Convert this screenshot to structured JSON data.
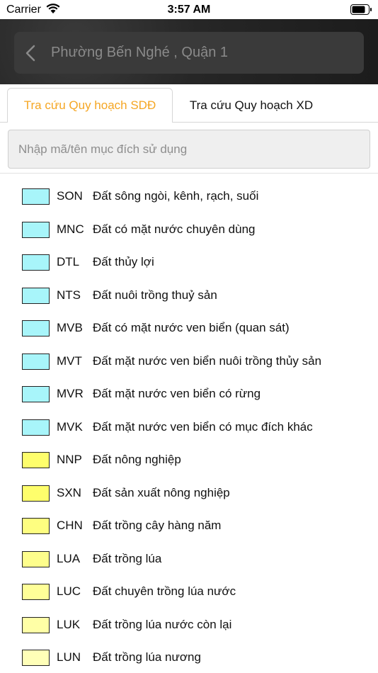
{
  "status_bar": {
    "carrier": "Carrier",
    "time": "3:57 AM",
    "icons": [
      "wifi-icon",
      "battery-icon"
    ]
  },
  "header": {
    "title": "Phường Bến Nghé , Quận 1",
    "back_icon": "chevron-left-icon"
  },
  "tabs": [
    {
      "label": "Tra cứu Quy hoạch SDĐ",
      "active": true
    },
    {
      "label": "Tra cứu Quy hoạch XD",
      "active": false
    }
  ],
  "search": {
    "placeholder": "Nhập mã/tên mục đích sử dụng"
  },
  "colors": {
    "active_tab": "#f5a623",
    "water": "#a8f5fa",
    "agri": "#fefe6c",
    "agri_light": "#ffff98",
    "agri_lighter": "#ffffb0"
  },
  "items": [
    {
      "code": "SON",
      "name": "Đất sông ngòi, kênh, rạch, suối",
      "color": "#a8f5fa"
    },
    {
      "code": "MNC",
      "name": "Đất có mặt nước chuyên dùng",
      "color": "#a8f5fa"
    },
    {
      "code": "DTL",
      "name": "Đất thủy lợi",
      "color": "#a8f5fa"
    },
    {
      "code": "NTS",
      "name": "Đất nuôi trồng thuỷ sản",
      "color": "#a8f5fa"
    },
    {
      "code": "MVB",
      "name": "Đất có mặt nước ven biển (quan sát)",
      "color": "#a8f5fa"
    },
    {
      "code": "MVT",
      "name": "Đất mặt nước ven biển nuôi trồng thủy sản",
      "color": "#a8f5fa"
    },
    {
      "code": "MVR",
      "name": "Đất mặt nước ven biển có rừng",
      "color": "#a8f5fa"
    },
    {
      "code": "MVK",
      "name": "Đất mặt nước ven biển có mục đích khác",
      "color": "#a8f5fa"
    },
    {
      "code": "NNP",
      "name": "Đất nông nghiệp",
      "color": "#fefe6c"
    },
    {
      "code": "SXN",
      "name": "Đất sản xuất nông nghiệp",
      "color": "#fefe6c"
    },
    {
      "code": "CHN",
      "name": "Đất trồng cây hàng năm",
      "color": "#fefe80"
    },
    {
      "code": "LUA",
      "name": "Đất trồng lúa",
      "color": "#fefe8c"
    },
    {
      "code": "LUC",
      "name": "Đất chuyên trồng lúa nước",
      "color": "#ffff98"
    },
    {
      "code": "LUK",
      "name": "Đất trồng lúa nước còn lại",
      "color": "#ffffa6"
    },
    {
      "code": "LUN",
      "name": "Đất trồng lúa nương",
      "color": "#ffffb8"
    }
  ]
}
